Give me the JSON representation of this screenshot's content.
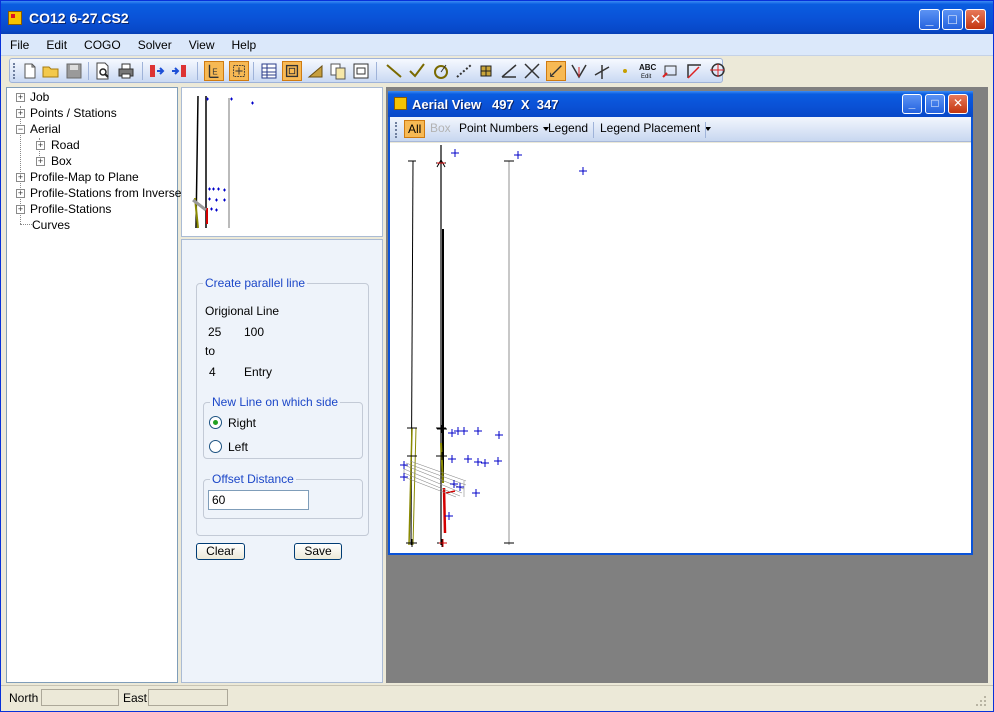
{
  "window": {
    "title": "CO12 6-27.CS2"
  },
  "menu": [
    "File",
    "Edit",
    "COGO",
    "Solver",
    "View",
    "Help"
  ],
  "toolbar_icons": [
    "new-icon",
    "open-icon",
    "save-icon",
    "print-preview-icon",
    "print-icon",
    "export-icon",
    "import-icon",
    "text-mode-icon",
    "select-points-icon",
    "table-icon",
    "frame-icon",
    "profile-icon",
    "copy-icon",
    "window-icon",
    "line-icon",
    "check-icon",
    "curve-icon",
    "dotted-line-icon",
    "grid-point-icon",
    "angle-icon",
    "intersect-icon",
    "diagonal-icon",
    "bisect-icon",
    "perpendicular-icon",
    "point-icon",
    "abc-edit-icon",
    "polygon-icon",
    "arc-icon",
    "circle-icon"
  ],
  "tree": [
    {
      "label": "Job",
      "expanded": false
    },
    {
      "label": "Points / Stations",
      "expanded": false
    },
    {
      "label": "Aerial",
      "expanded": true,
      "children": [
        {
          "label": "Road",
          "expanded": false
        },
        {
          "label": "Box",
          "expanded": false
        }
      ]
    },
    {
      "label": "Profile-Map to Plane",
      "expanded": false
    },
    {
      "label": "Profile-Stations from Inverse",
      "expanded": false
    },
    {
      "label": "Profile-Stations",
      "expanded": false
    },
    {
      "label": "Curves"
    }
  ],
  "form": {
    "group_title": "Create parallel line",
    "original_line_label": "Origional Line",
    "from_point": "25",
    "from_value": "100",
    "to_label": "to",
    "to_point": "4",
    "to_value": "Entry",
    "side_group_title": "New Line on which side",
    "side_right": "Right",
    "side_left": "Left",
    "side_selected": "Right",
    "offset_group_title": "Offset Distance",
    "offset_value": "60",
    "clear_label": "Clear",
    "save_label": "Save"
  },
  "aerial": {
    "title": "Aerial View   497  X  347",
    "toolbar": {
      "all": "All",
      "box": "Box",
      "point_numbers": "Point Numbers",
      "legend": "Legend",
      "legend_placement": "Legend Placement"
    }
  },
  "status": {
    "north_label": "North",
    "north_value": "",
    "east_label": "East",
    "east_value": ""
  },
  "colors": {
    "title_blue": "#0a53d8",
    "point_marker": "#0000c8",
    "selected_line": "#d40000",
    "road_line": "#8a8a00",
    "toolbar_active": "#f7b954"
  }
}
